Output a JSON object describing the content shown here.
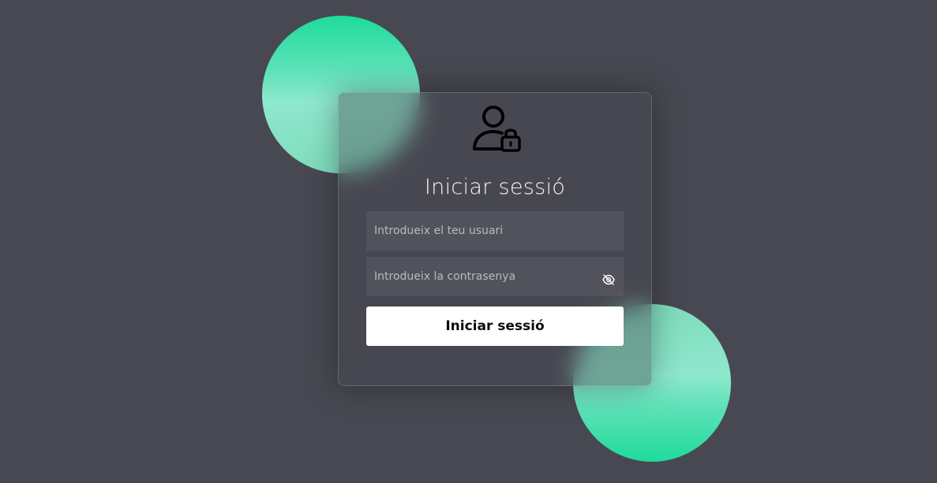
{
  "login": {
    "title": "Iniciar sessió",
    "username_placeholder": "Introdueix el teu usuari",
    "password_placeholder": "Introdueix la contrasenya",
    "submit_label": "Iniciar sessió"
  },
  "icons": {
    "header": "user-lock-icon",
    "password_toggle": "eye-slash-icon"
  },
  "colors": {
    "background": "#484852",
    "accent_green": "#1edb9b",
    "button_bg": "#ffffff"
  }
}
